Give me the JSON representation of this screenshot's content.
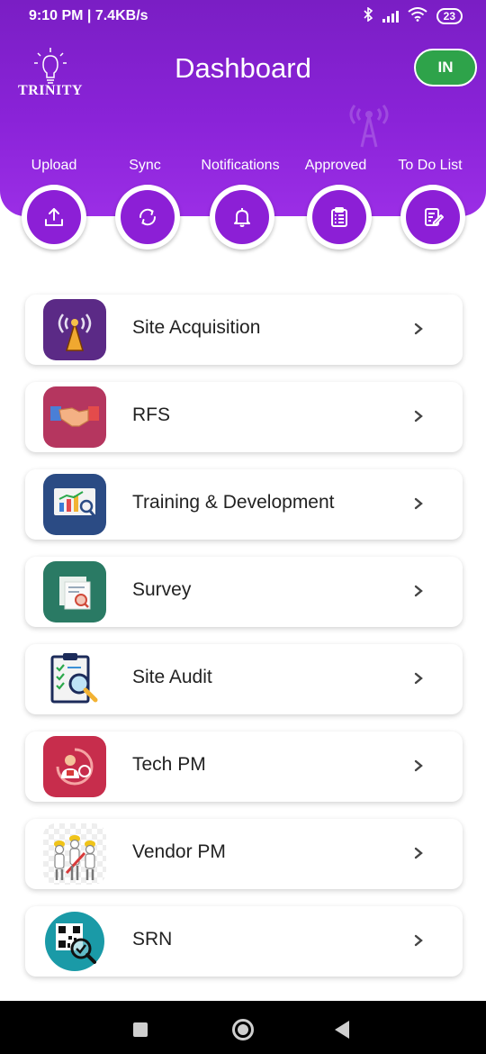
{
  "status_bar": {
    "time_speed": "9:10 PM | 7.4KB/s",
    "battery": "23"
  },
  "header": {
    "logo_text": "TRINITY",
    "title": "Dashboard",
    "in_button": "IN"
  },
  "actions": [
    {
      "label": "Upload",
      "icon": "upload-icon"
    },
    {
      "label": "Sync",
      "icon": "sync-icon"
    },
    {
      "label": "Notifications",
      "icon": "bell-icon"
    },
    {
      "label": "Approved",
      "icon": "clipboard-icon"
    },
    {
      "label": "To Do List",
      "icon": "todo-icon"
    }
  ],
  "menu": [
    {
      "label": "Site Acquisition",
      "icon": "tower-icon"
    },
    {
      "label": "RFS",
      "icon": "handshake-icon"
    },
    {
      "label": "Training & Development",
      "icon": "presentation-icon"
    },
    {
      "label": "Survey",
      "icon": "survey-icon"
    },
    {
      "label": "Site Audit",
      "icon": "audit-icon"
    },
    {
      "label": "Tech PM",
      "icon": "tech-pm-icon"
    },
    {
      "label": "Vendor PM",
      "icon": "vendor-pm-icon"
    },
    {
      "label": "SRN",
      "icon": "qr-icon"
    }
  ],
  "colors": {
    "header_purple": "#8a23d8",
    "action_purple": "#8c1fd6",
    "in_button_green": "#2ea34a"
  }
}
